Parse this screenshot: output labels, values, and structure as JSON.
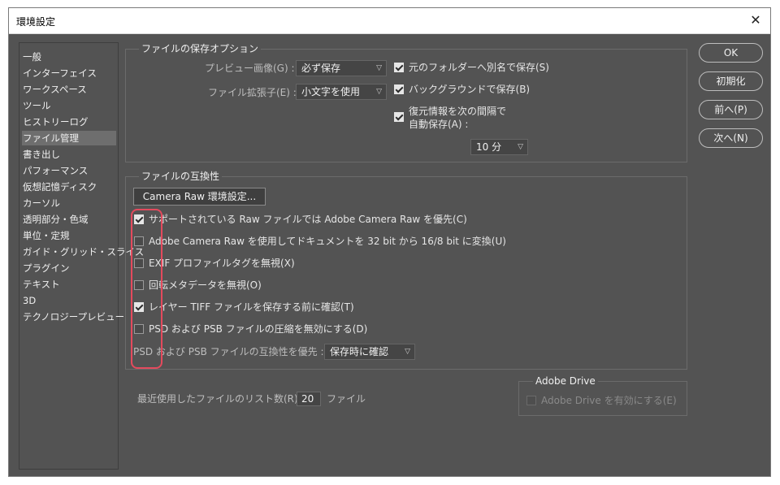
{
  "window": {
    "title": "環境設定",
    "close_glyph": "✕"
  },
  "sidebar": {
    "items": [
      {
        "label": "一般"
      },
      {
        "label": "インターフェイス"
      },
      {
        "label": "ワークスペース"
      },
      {
        "label": "ツール"
      },
      {
        "label": "ヒストリーログ"
      },
      {
        "label": "ファイル管理",
        "selected": true
      },
      {
        "label": "書き出し"
      },
      {
        "label": "パフォーマンス"
      },
      {
        "label": "仮想記憶ディスク"
      },
      {
        "label": "カーソル"
      },
      {
        "label": "透明部分・色域"
      },
      {
        "label": "単位・定規"
      },
      {
        "label": "ガイド・グリッド・スライス"
      },
      {
        "label": "プラグイン"
      },
      {
        "label": "テキスト"
      },
      {
        "label": "3D"
      },
      {
        "label": "テクノロジープレビュー"
      }
    ]
  },
  "save_options": {
    "title": "ファイルの保存オプション",
    "preview_label": "プレビュー画像(G) :",
    "preview_value": "必ず保存",
    "extension_label": "ファイル拡張子(E) :",
    "extension_value": "小文字を使用",
    "save_alongside": {
      "label": "元のフォルダーへ別名で保存(S)",
      "checked": true
    },
    "save_background": {
      "label": "バックグラウンドで保存(B)",
      "checked": true
    },
    "autosave": {
      "label_line1": "復元情報を次の間隔で",
      "label_line2": "自動保存(A) :",
      "checked": true
    },
    "autosave_interval": "10 分"
  },
  "compat": {
    "title": "ファイルの互換性",
    "camera_raw_button": "Camera Raw 環境設定...",
    "options": [
      {
        "label": "サポートされている Raw ファイルでは Adobe Camera Raw を優先(C)",
        "checked": true
      },
      {
        "label": "Adobe Camera Raw を使用してドキュメントを 32 bit から 16/8 bit に変換(U)",
        "checked": false
      },
      {
        "label": "EXIF プロファイルタグを無視(X)",
        "checked": false
      },
      {
        "label": "回転メタデータを無視(O)",
        "checked": false
      },
      {
        "label": "レイヤー TIFF ファイルを保存する前に確認(T)",
        "checked": true
      },
      {
        "label": "PSD および PSB ファイルの圧縮を無効にする(D)",
        "checked": false
      }
    ],
    "maximize_label": "PSD および PSB ファイルの互換性を優先 :",
    "maximize_value": "保存時に確認"
  },
  "recent": {
    "label": "最近使用したファイルのリスト数(R) :",
    "value": "20",
    "unit": "ファイル"
  },
  "adobe_drive": {
    "title": "Adobe Drive",
    "option_label": "Adobe Drive を有効にする(E)",
    "checked": false
  },
  "buttons": {
    "ok": "OK",
    "reset": "初期化",
    "prev": "前へ(P)",
    "next": "次へ(N)"
  },
  "colors": {
    "panel_bg": "#535353",
    "highlight": "#e44a5d"
  }
}
